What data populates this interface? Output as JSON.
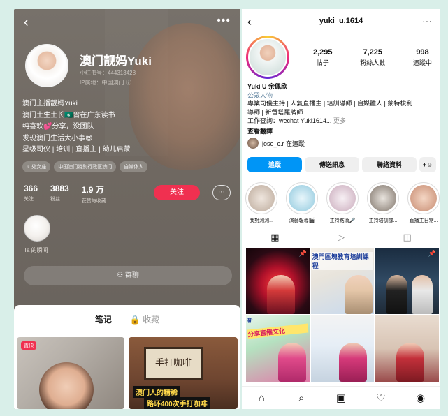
{
  "xhs": {
    "name": "澳门靓妈Yuki",
    "red_id": "小红书号：444313428",
    "ip": "IP属地：中国澳门 ⓘ",
    "bio": [
      "澳门主播靓妈Yuki",
      "澳门土生土长🇲🇴曾在广东读书",
      "纯喜欢💕分享，没团队",
      "发现澳门生活大小事😍",
      "星级司仪 | 培训 | 直播主 | 幼儿启蒙"
    ],
    "tags": [
      "♀ 处女座",
      "中国澳门特别行政区澳门",
      "自媒体人"
    ],
    "stats": [
      {
        "num": "366",
        "label": "关注"
      },
      {
        "num": "3883",
        "label": "粉丝"
      },
      {
        "num": "1.9 万",
        "label": "获赞与收藏"
      }
    ],
    "follow_label": "关注",
    "moment_label": "Ta 的瞬间",
    "group_chat": "⚇ 群聊",
    "tabs": [
      "笔记",
      "🔒 收藏"
    ],
    "post1_badge": "置顶",
    "post2_sign": "手打咖啡",
    "post2_caption1": "澳门人的精稀",
    "post2_caption2": "路环400次手打咖啡",
    "colors": {
      "accent": "#f03050"
    }
  },
  "ig": {
    "handle": "yuki_u.1614",
    "stats": [
      {
        "num": "2,295",
        "label": "帖子"
      },
      {
        "num": "7,225",
        "label": "粉絲人數"
      },
      {
        "num": "998",
        "label": "追蹤中"
      }
    ],
    "display_name": "Yuki U 余佩欣",
    "category": "公眾人物",
    "bio_lines": [
      "專業司儀主持 | 人氣直播主 | 培訓導師 | 自媒體人 | 蒙特梭利",
      "導師 | 新督塔羅牌師",
      "工作查詢：wechat Yuki1614..."
    ],
    "bio_more": "更多",
    "translate": "查看翻譯",
    "followed_by": "jose_c.r 在追蹤",
    "buttons": {
      "follow": "追蹤",
      "message": "傳送訊息",
      "contact": "聯絡資料",
      "add": "+☺"
    },
    "highlights": [
      "我對測測...",
      "演藝報導🎬",
      "主持點滴🎤",
      "主持培訓課...",
      "直播主日常..."
    ],
    "grid_text": {
      "c2": "澳門區塊教育培訓課程",
      "c4_small": "新",
      "c4": "分享直播文化"
    },
    "colors": {
      "follow": "#0095f6",
      "category": "#5a7e9b"
    }
  }
}
